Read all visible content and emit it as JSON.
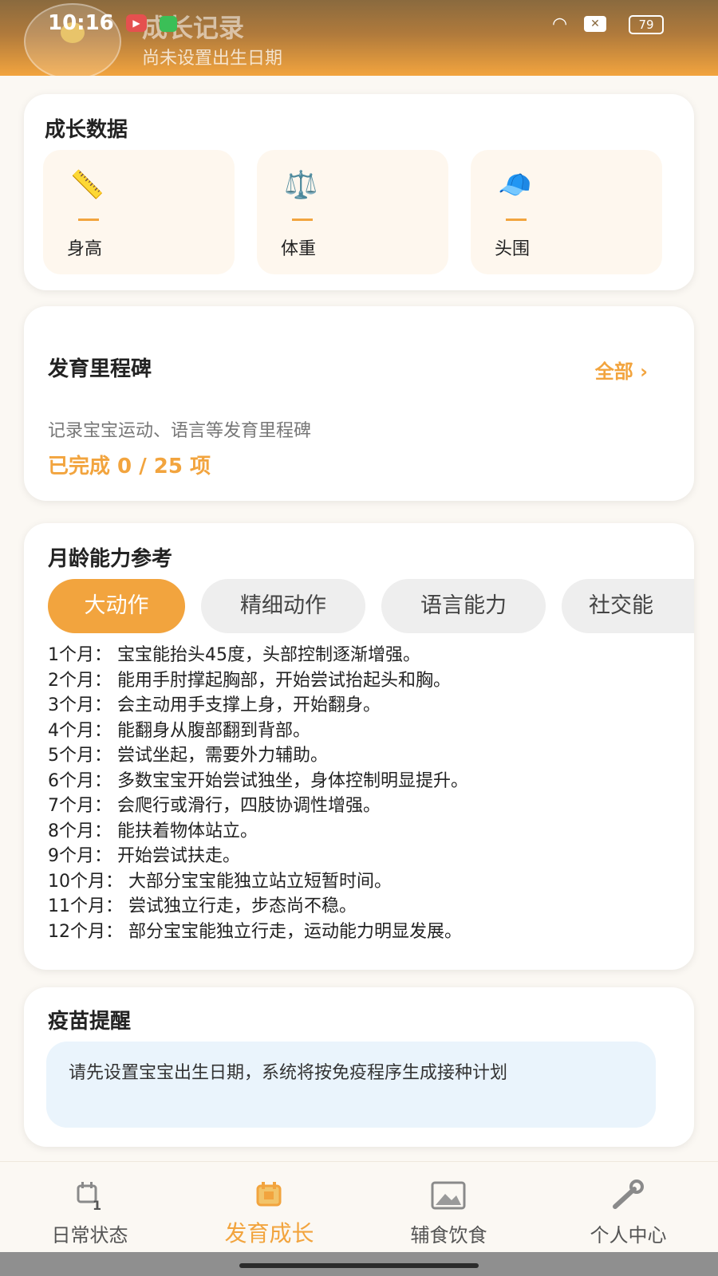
{
  "status_bar": {
    "time": "10:16",
    "battery": "79",
    "icons": [
      "play-record-icon",
      "grid-app-icon",
      "wifi-icon",
      "close-x-icon",
      "battery-icon"
    ]
  },
  "header": {
    "title": "成长记录",
    "subtitle": "尚未设置出生日期"
  },
  "growth_data": {
    "title": "成长数据",
    "metrics": [
      {
        "label": "身高",
        "value": "—",
        "icon": "ruler-icon"
      },
      {
        "label": "体重",
        "value": "—",
        "icon": "scale-icon"
      },
      {
        "label": "头围",
        "value": "—",
        "icon": "cap-icon"
      }
    ]
  },
  "milestones": {
    "title": "发育里程碑",
    "all_link": "全部 ›",
    "description": "记录宝宝运动、语言等发育里程碑",
    "progress": "已完成 0 / 25 项"
  },
  "ability": {
    "title": "月龄能力参考",
    "tabs": [
      "大动作",
      "精细动作",
      "语言能力",
      "社交能"
    ],
    "active_tab": "大动作",
    "rows": [
      "1个月：  宝宝能抬头45度，头部控制逐渐增强。",
      "2个月：  能用手肘撑起胸部，开始尝试抬起头和胸。",
      "3个月：  会主动用手支撑上身，开始翻身。",
      "4个月：  能翻身从腹部翻到背部。",
      "5个月：  尝试坐起，需要外力辅助。",
      "6个月：  多数宝宝开始尝试独坐，身体控制明显提升。",
      "7个月：  会爬行或滑行，四肢协调性增强。",
      "8个月：  能扶着物体站立。",
      "9个月：  开始尝试扶走。",
      "10个月：  大部分宝宝能独立站立短暂时间。",
      "11个月：  尝试独立行走，步态尚不稳。",
      "12个月：  部分宝宝能独立行走，运动能力明显发展。"
    ]
  },
  "vaccine": {
    "title": "疫苗提醒",
    "notice": "请先设置宝宝出生日期，系统将按免疫程序生成接种计划"
  },
  "bottom_nav": {
    "items": [
      {
        "label": "日常状态",
        "icon": "calendar-icon"
      },
      {
        "label": "发育成长",
        "icon": "growth-calendar-icon"
      },
      {
        "label": "辅食饮食",
        "icon": "image-icon"
      },
      {
        "label": "个人中心",
        "icon": "wrench-icon"
      }
    ],
    "active": "发育成长"
  },
  "colors": {
    "accent": "#f2a43e",
    "background": "#fbf8f3",
    "notice_bg": "#eaf4fc"
  }
}
